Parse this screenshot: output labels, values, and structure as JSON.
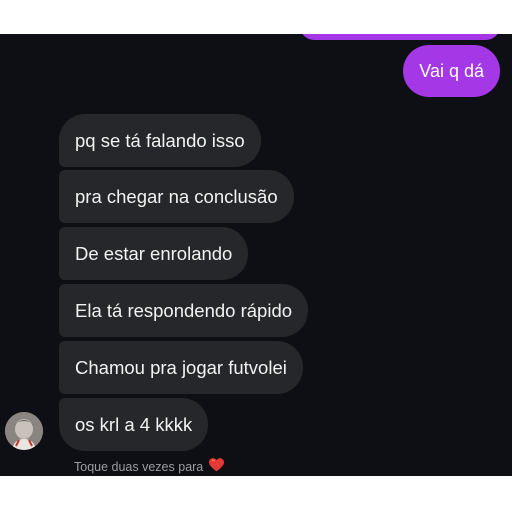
{
  "sent": {
    "last_message": "Vai q dá",
    "bubble_color": "#a438e6"
  },
  "received": {
    "messages": [
      "pq se tá falando isso",
      "pra chegar na conclusão",
      "De estar enrolando",
      "Ela tá respondendo rápido",
      "Chamou pra jogar futvolei",
      "os krl a 4 kkkk"
    ],
    "bubble_color": "#26272b"
  },
  "reaction_hint": "Toque duas vezes para",
  "reaction_icon": "heart-icon",
  "background_color": "#0d0f14"
}
